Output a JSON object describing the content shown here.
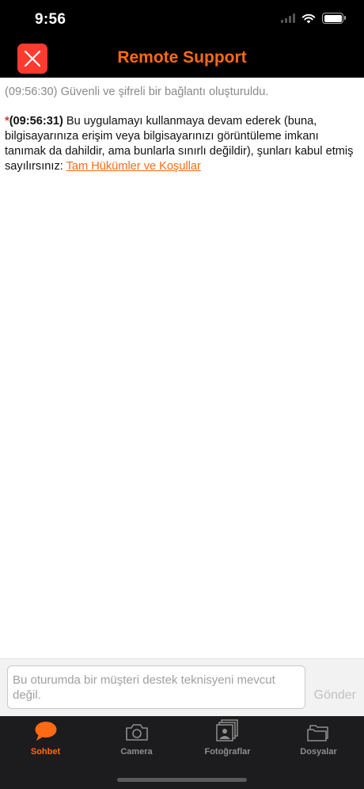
{
  "status_bar": {
    "time": "9:56"
  },
  "header": {
    "title": "Remote Support"
  },
  "chat": {
    "system_message": "(09:56:30) Güvenli ve şifreli bir bağlantı oluşturuldu.",
    "main_message": {
      "marker": "*",
      "time": "(09:56:31)",
      "text": " Bu uygulamayı kullanmaya devam ederek (buna, bilgisayarınıza erişim veya bilgisayarınızı görüntüleme imkanı tanımak da dahildir, ama bunlarla sınırlı değildir), şunları kabul etmiş sayılırsınız: ",
      "link": "Tam Hükümler ve Koşullar"
    }
  },
  "input": {
    "placeholder": "Bu oturumda bir müşteri destek teknisyeni mevcut değil.",
    "send_label": "Gönder"
  },
  "tabs": [
    {
      "label": "Sohbet",
      "icon": "chat-bubble-icon",
      "active": true
    },
    {
      "label": "Camera",
      "icon": "camera-icon",
      "active": false
    },
    {
      "label": "Fotoğraflar",
      "icon": "photos-icon",
      "active": false
    },
    {
      "label": "Dosyalar",
      "icon": "folder-icon",
      "active": false
    }
  ],
  "colors": {
    "accent": "#ff6a13",
    "close": "#ff3b30",
    "tab_bar": "#1c1c1e"
  }
}
